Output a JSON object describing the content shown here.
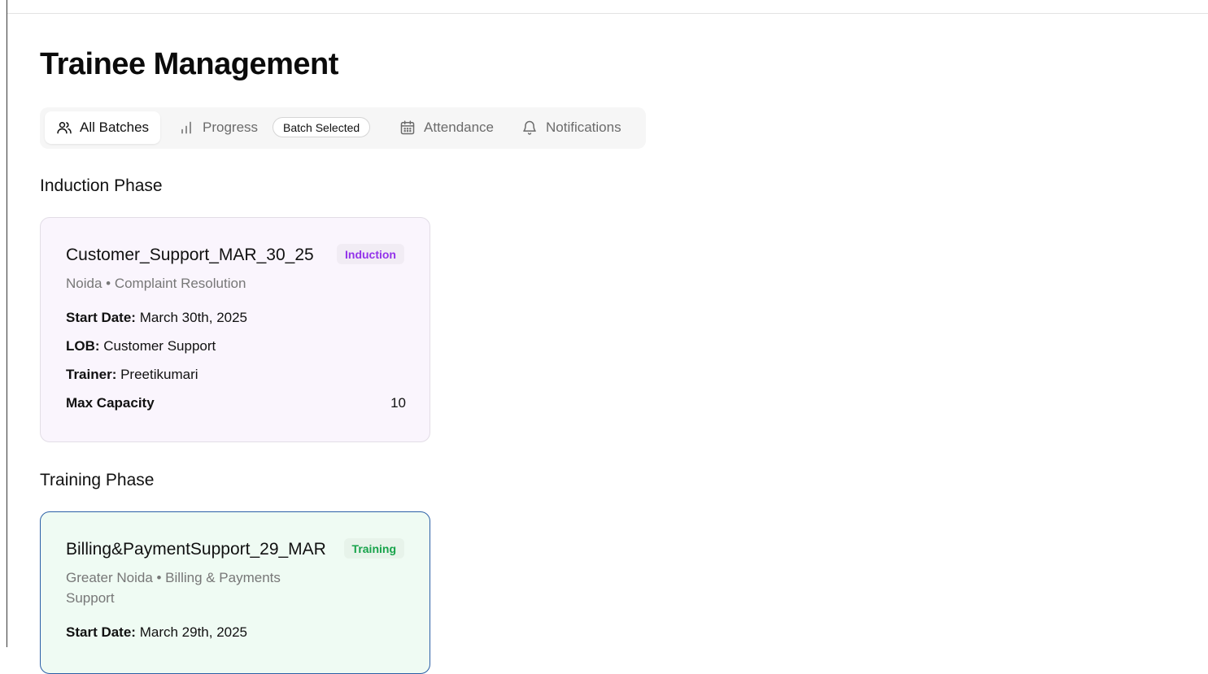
{
  "page": {
    "title": "Trainee Management"
  },
  "tabs": [
    {
      "label": "All Batches",
      "icon": "users-icon",
      "active": true
    },
    {
      "label": "Progress",
      "icon": "bar-chart-icon",
      "active": false
    },
    {
      "label": "Attendance",
      "icon": "calendar-icon",
      "active": false
    },
    {
      "label": "Notifications",
      "icon": "bell-icon",
      "active": false
    }
  ],
  "batch_badge": "Batch Selected",
  "sections": {
    "induction": {
      "title": "Induction Phase",
      "card": {
        "name": "Customer_Support_MAR_30_25",
        "phase": "Induction",
        "location": "Noida • Complaint Resolution",
        "start_label": "Start Date:",
        "start_value": "March 30th, 2025",
        "lob_label": "LOB:",
        "lob_value": "Customer Support",
        "trainer_label": "Trainer:",
        "trainer_value": "Preetikumari",
        "capacity_label": "Max Capacity",
        "capacity_value": "10"
      }
    },
    "training": {
      "title": "Training Phase",
      "card": {
        "name": "Billing&PaymentSupport_29_MAR",
        "phase": "Training",
        "location": "Greater Noida • Billing & Payments Support",
        "start_label": "Start Date:",
        "start_value": "March 29th, 2025"
      }
    }
  },
  "colors": {
    "induction_accent": "#9333ea",
    "training_accent": "#16a34a",
    "induction_card_bg": "#faf5fd",
    "training_card_bg": "#effbf3",
    "selected_card_border": "#2b5fa6"
  }
}
